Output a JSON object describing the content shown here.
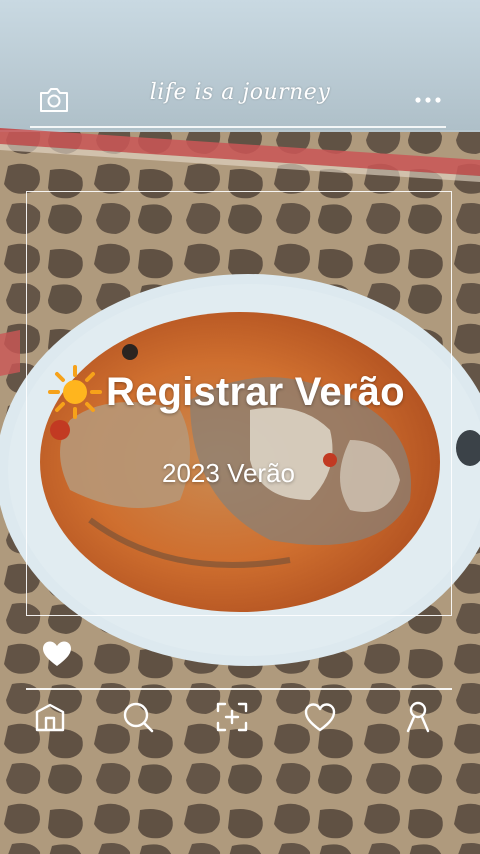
{
  "header": {
    "tagline": "life is a journey",
    "camera_icon": "camera-icon",
    "more_icon": "more-dots-icon"
  },
  "card": {
    "title_emoji": "sun-icon",
    "title": "Registrar Verão",
    "subtitle": "2023 Verão",
    "like_icon": "heart-filled-icon"
  },
  "nav": {
    "items": [
      {
        "icon": "home-icon"
      },
      {
        "icon": "search-icon"
      },
      {
        "icon": "add-photo-icon"
      },
      {
        "icon": "heart-outline-icon"
      },
      {
        "icon": "profile-icon"
      }
    ]
  },
  "colors": {
    "overlay_white": "#ffffff",
    "plate": "#d9e6ec",
    "stew": "#d2773a",
    "tablecloth_dark": "#4a3b2c",
    "tablecloth_light": "#a08a6c",
    "sky_top": "#cfdde6"
  }
}
